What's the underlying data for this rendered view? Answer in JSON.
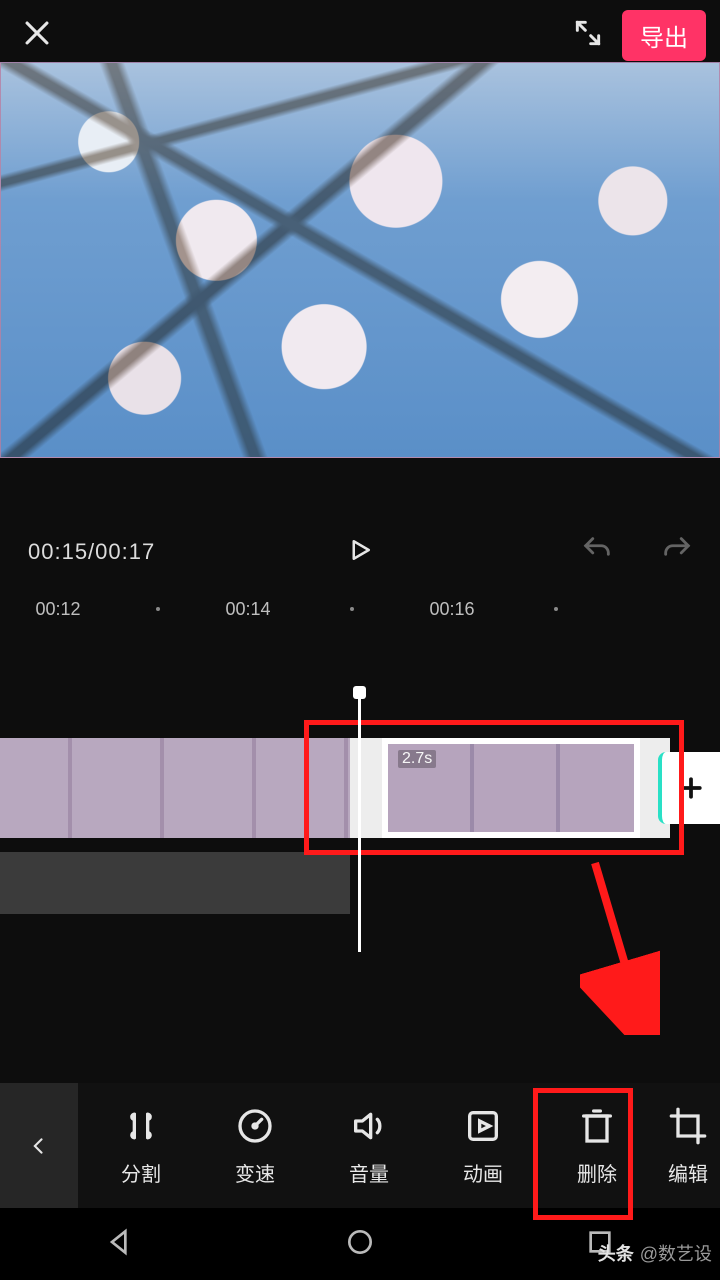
{
  "header": {
    "export_label": "导出"
  },
  "playback": {
    "time_display": "00:15/00:17"
  },
  "ruler": {
    "ticks": [
      "00:12",
      "·",
      "00:14",
      "·",
      "00:16",
      "·"
    ]
  },
  "timeline": {
    "selected_clip_duration": "2.7s"
  },
  "toolbar": {
    "items": [
      {
        "id": "split",
        "label": "分割"
      },
      {
        "id": "speed",
        "label": "变速"
      },
      {
        "id": "volume",
        "label": "音量"
      },
      {
        "id": "anim",
        "label": "动画"
      },
      {
        "id": "delete",
        "label": "删除"
      },
      {
        "id": "edit",
        "label": "编辑"
      }
    ]
  },
  "footer": {
    "brand": "头条",
    "author": "@数艺设"
  },
  "annotation": {
    "highlighted_tool": "delete"
  },
  "colors": {
    "accent": "#ff3366",
    "annotation": "#ff1a1a"
  }
}
